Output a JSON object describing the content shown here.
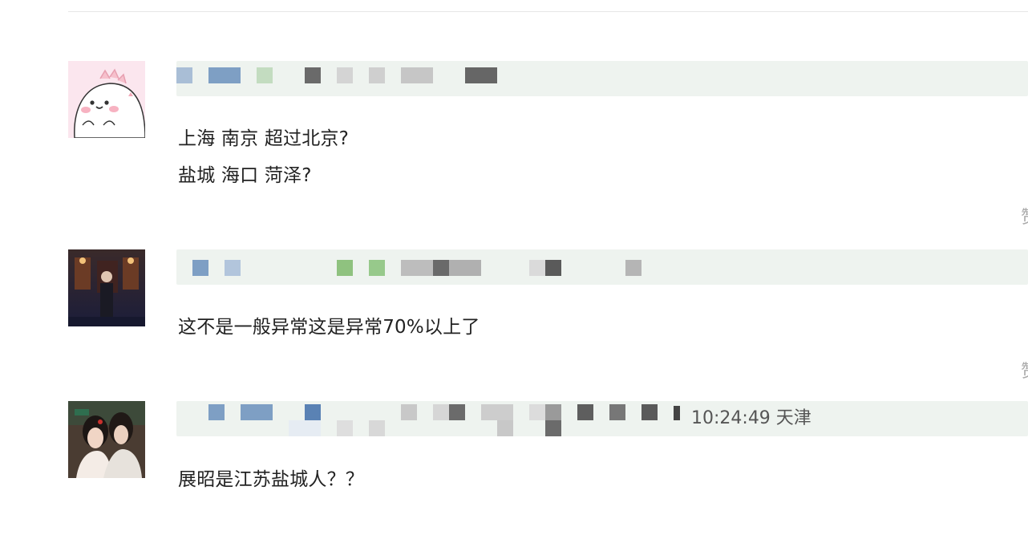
{
  "comments": [
    {
      "lines": [
        "上海 南京 超过北京?",
        "盐城 海口 菏泽?"
      ],
      "meta": "",
      "side_char": "赞"
    },
    {
      "lines": [
        "这不是一般异常这是异常70%以上了"
      ],
      "meta": "",
      "side_char": "赞"
    },
    {
      "lines": [
        "展昭是江苏盐城人？？"
      ],
      "meta": "10:24:49 天津",
      "side_char": ""
    }
  ],
  "colors": {
    "meta_bar_bg": "#eef3ef",
    "pixel_blue": "#7e9fc4",
    "pixel_green": "#8fc27f",
    "pixel_gray": "#8a8a8a",
    "text": "#222222"
  }
}
